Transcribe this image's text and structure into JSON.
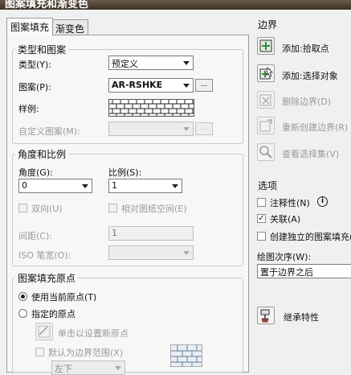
{
  "window": {
    "title": "图案填充和渐变色"
  },
  "tabs": [
    {
      "label": "图案填充",
      "active": true
    },
    {
      "label": "渐变色",
      "active": false
    }
  ],
  "type_pattern": {
    "title": "类型和图案",
    "type_label": "类型(Y):",
    "type_value": "预定义",
    "pattern_label": "图案(P):",
    "pattern_value": "AR-RSHKE",
    "browse_label": "...",
    "swatch_label": "样例:",
    "custom_label": "自定义图案(M):",
    "custom_value": ""
  },
  "angle_scale": {
    "title": "角度和比例",
    "angle_label": "角度(G):",
    "angle_value": "0",
    "scale_label": "比例(S):",
    "scale_value": "1",
    "double_label": "双向(U)",
    "paper_space_label": "相对图纸空间(E)",
    "spacing_label": "间距(C):",
    "spacing_value": "1",
    "iso_label": "ISO 笔宽(O):",
    "iso_value": ""
  },
  "origin": {
    "title": "图案填充原点",
    "use_current_label": "使用当前原点(T)",
    "specified_label": "指定的原点",
    "click_set_label": "单击以设置新原点",
    "default_extent_label": "默认为边界范围(X)",
    "position_value": "左下"
  },
  "boundaries": {
    "title": "边界",
    "add_pick_label": "添加:拾取点",
    "add_select_label": "添加:选择对象",
    "remove_label": "删除边界(D)",
    "recreate_label": "重新创建边界(R)",
    "view_label": "查看选择集(V)"
  },
  "options": {
    "title": "选项",
    "annotative_label": "注释性(N)",
    "info_glyph": "i",
    "associative_label": "关联(A)",
    "separate_label": "创建独立的图案填充(H)",
    "draw_order_label": "绘图次序(W):",
    "draw_order_value": "置于边界之后"
  },
  "inherit": {
    "label": "继承特性"
  },
  "colors": {
    "accent_green": "#2e8b3a",
    "arrow_red": "#c0392b"
  }
}
